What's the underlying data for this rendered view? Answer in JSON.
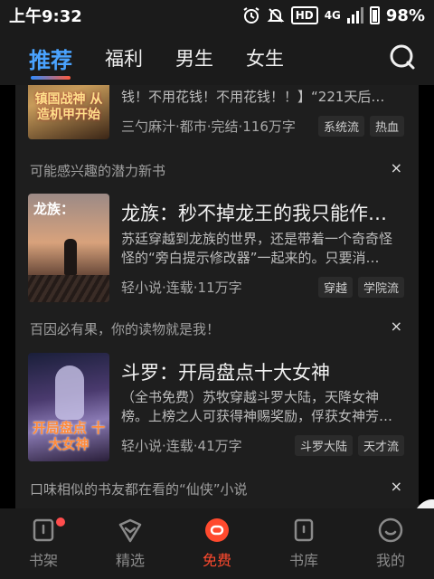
{
  "status": {
    "time": "上午9:32",
    "hd": "HD",
    "network": "4G",
    "battery": "98%"
  },
  "tabs": [
    {
      "label": "推荐",
      "active": true
    },
    {
      "label": "福利",
      "active": false
    },
    {
      "label": "男生",
      "active": false
    },
    {
      "label": "女生",
      "active": false
    }
  ],
  "book0": {
    "desc": "钱！不用花钱！不用花钱！！】“221天后…",
    "meta": "三勺麻汁·都市·完结·116万字",
    "tags": [
      "系统流",
      "热血"
    ],
    "cover_text": "镇国战神 从造机甲开始"
  },
  "section1": {
    "title": "可能感兴趣的潜力新书",
    "close": "×"
  },
  "book1": {
    "title": "龙族：秒不掉龙王的我只能作…",
    "desc": "苏廷穿越到龙族的世界，还是带着一个奇奇怪怪的“旁白提示修改器”一起来的。只要消…",
    "meta": "轻小说·连载·11万字",
    "tags": [
      "穿越",
      "学院流"
    ],
    "cover_text": "龙族："
  },
  "section2": {
    "title": "百因必有果，你的读物就是我！",
    "close": "×"
  },
  "book2": {
    "title": "斗罗：开局盘点十大女神",
    "desc": "（全书免费）苏牧穿越斗罗大陆，天降女神榜。上榜之人可获得神赐奖励，俘获女神芳…",
    "meta": "轻小说·连载·41万字",
    "tags": [
      "斗罗大陆",
      "天才流"
    ],
    "cover_text": "开局盘点 十大女神"
  },
  "section3": {
    "title": "口味相似的书友都在看的“仙侠”小说",
    "close": "×"
  },
  "nav": [
    {
      "label": "书架",
      "icon": "bookshelf-icon"
    },
    {
      "label": "精选",
      "icon": "featured-icon"
    },
    {
      "label": "免费",
      "icon": "free-icon",
      "active": true
    },
    {
      "label": "书库",
      "icon": "library-icon"
    },
    {
      "label": "我的",
      "icon": "profile-icon"
    }
  ],
  "colors": {
    "accent": "#4aa3ff",
    "active_nav": "#ff4a2e",
    "badge": "#ff4d4d"
  }
}
